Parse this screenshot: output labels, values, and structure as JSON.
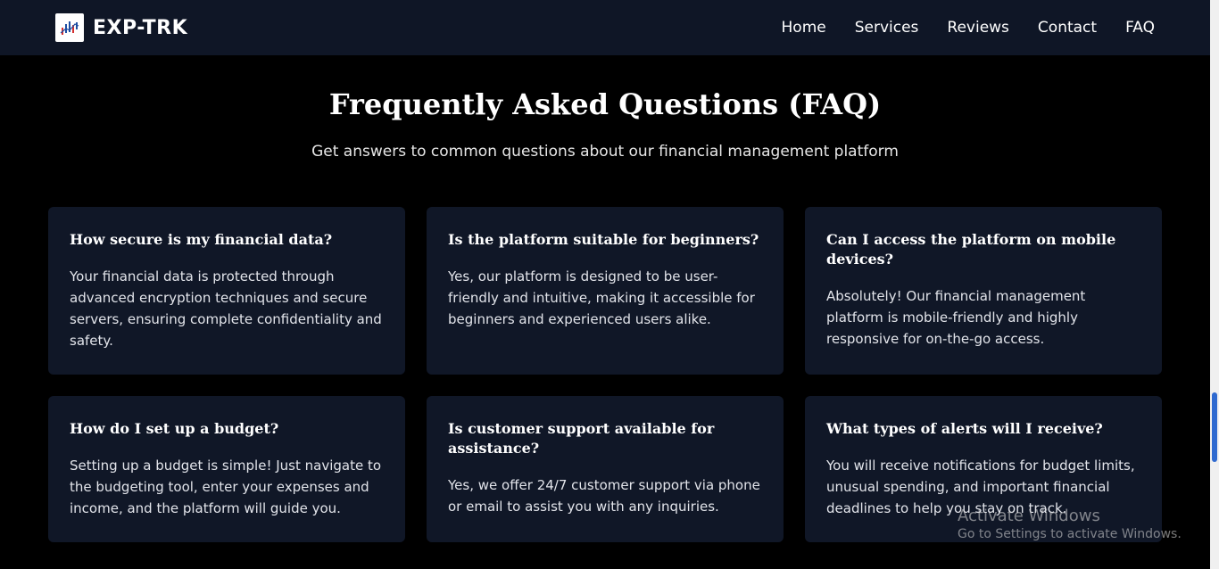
{
  "nav": {
    "brand": "EXP-TRK",
    "links": [
      "Home",
      "Services",
      "Reviews",
      "Contact",
      "FAQ"
    ]
  },
  "faq": {
    "title": "Frequently Asked Questions (FAQ)",
    "subtitle": "Get answers to common questions about our financial management platform",
    "items": [
      {
        "question": "How secure is my financial data?",
        "answer": "Your financial data is protected through advanced encryption techniques and secure servers, ensuring complete confidentiality and safety."
      },
      {
        "question": "Is the platform suitable for beginners?",
        "answer": "Yes, our platform is designed to be user-friendly and intuitive, making it accessible for beginners and experienced users alike."
      },
      {
        "question": "Can I access the platform on mobile devices?",
        "answer": "Absolutely! Our financial management platform is mobile-friendly and highly responsive for on-the-go access."
      },
      {
        "question": "How do I set up a budget?",
        "answer": "Setting up a budget is simple! Just navigate to the budgeting tool, enter your expenses and income, and the platform will guide you."
      },
      {
        "question": "Is customer support available for assistance?",
        "answer": "Yes, we offer 24/7 customer support via phone or email to assist you with any inquiries."
      },
      {
        "question": "What types of alerts will I receive?",
        "answer": "You will receive notifications for budget limits, unusual spending, and important financial deadlines to help you stay on track."
      }
    ]
  },
  "watermark": {
    "title": "Activate Windows",
    "subtitle": "Go to Settings to activate Windows."
  },
  "colors": {
    "background": "#000000",
    "navbar": "#0f1626",
    "card": "#101727",
    "scrollbar_thumb": "#2f6ad0"
  }
}
